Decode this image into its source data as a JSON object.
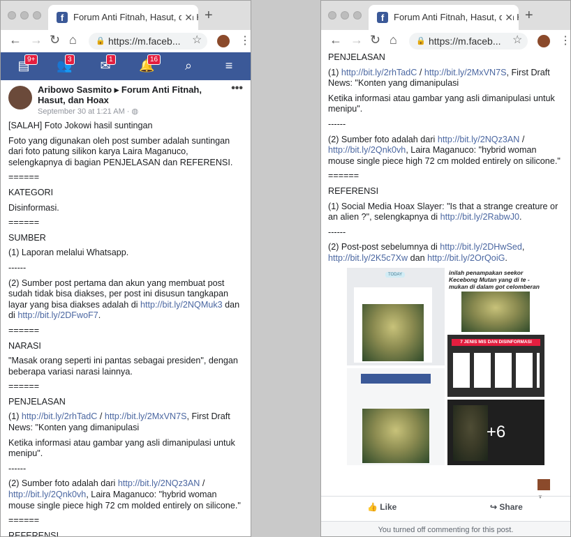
{
  "browser": {
    "tab_title": "Forum Anti Fitnah, Hasut, dan Hoax",
    "url": "https://m.faceb..."
  },
  "fb_nav": {
    "badges": [
      "9+",
      "3",
      "1",
      "16"
    ]
  },
  "post": {
    "author_line": "Aribowo Sasmito ▸ Forum Anti Fitnah, Hasut, dan Hoax",
    "timestamp": "September 30 at 1:21 AM · ",
    "left_lines": [
      "[SALAH] Foto Jokowi hasil suntingan",
      "Foto yang digunakan oleh post sumber adalah suntingan dari foto patung silikon karya Laira Maganuco, selengkapnya di bagian PENJELASAN dan REFERENSI.",
      "======",
      "KATEGORI",
      "Disinformasi.",
      "======",
      "SUMBER",
      "(1) Laporan melalui Whatsapp.",
      "------"
    ],
    "sumber2_text": "(2) Sumber post pertama dan akun yang membuat post sudah tidak bisa diakses, per post ini disusun tangkapan layar yang bisa diakses adalah di ",
    "sumber2_link1": "http://bit.ly/2NQMuk3",
    "sumber2_mid": " dan di ",
    "sumber2_link2": "http://bit.ly/2DFwoF7",
    "sumber2_end": ".",
    "sep1": "======",
    "narasi_title": "NARASI",
    "narasi_text": "\"Masak orang seperti ini pantas sebagai presiden\", dengan beberapa variasi narasi lainnya.",
    "sep2": "======",
    "penjelasan_title": "PENJELASAN",
    "p1_prefix": "(1) ",
    "p1_link1": "http://bit.ly/2rhTadC",
    "p1_sep": " / ",
    "p1_link2": "http://bit.ly/2MxVN7S",
    "p1_text": ", First Draft News: \"Konten yang dimanipulasi",
    "p1_line2": "Ketika informasi atau gambar yang asli dimanipulasi untuk menipu\".",
    "dash": "------",
    "p2_prefix": "(2) Sumber foto adalah dari ",
    "p2_link1": "http://bit.ly/2NQz3AN",
    "p2_sep": " / ",
    "p2_link2": "http://bit.ly/2Qnk0vh",
    "p2_text": ", Laira Maganuco: \"hybrid woman mouse single piece high 72 cm molded entirely on silicone.\"",
    "sep3": "======",
    "referensi_title": "REFERENSI",
    "r1_text": "(1) Social Media Hoax Slayer: \"Is that a strange creature or an alien ?\", selengkapnya di ",
    "r1_link": "http://bit.ly/2RabwJ0",
    "r1_end": ".",
    "r2_prefix": "(2) Post-post sebelumnya di ",
    "r2_link1": "http://bit.ly/2DHwSed",
    "r2_sep1": ", ",
    "r2_link2": "http://bit.ly/2K5c7Xw",
    "r2_sep2": " dan ",
    "r2_link3": "http://bit.ly/2OrQoiG",
    "r2_end": "."
  },
  "images": {
    "caption_b": "inilah penampakan seekor Kecebong Mutan yang di te - mukan di dalam got celomberan",
    "label_c": "7 JENIS MIS DAN DISINFORMASI",
    "today": "TODAY",
    "more_count": "+6"
  },
  "actions": {
    "like": "Like",
    "share": "Share",
    "notice": "You turned off commenting for this post."
  }
}
